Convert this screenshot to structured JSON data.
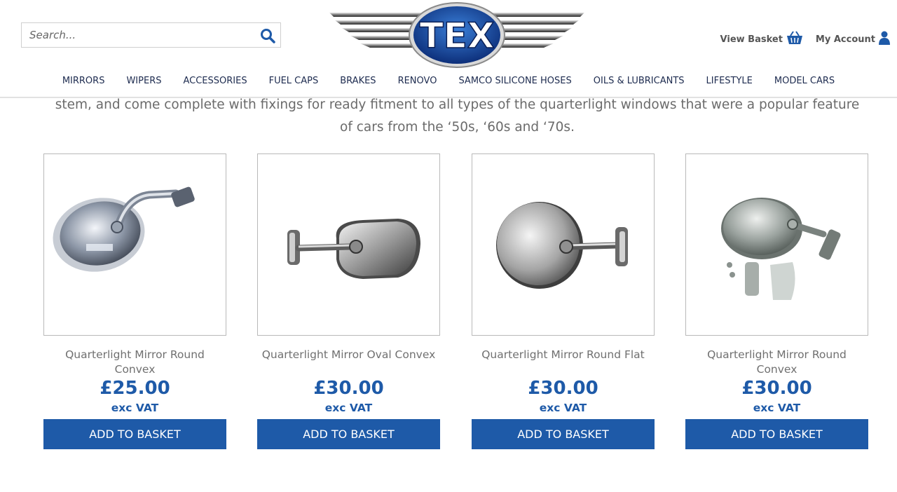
{
  "search": {
    "placeholder": "Search...",
    "value": ""
  },
  "logo": {
    "text": "TEX"
  },
  "account": {
    "basket_label": "View Basket",
    "account_label": "My Account"
  },
  "nav": {
    "items": [
      "MIRRORS",
      "WIPERS",
      "ACCESSORIES",
      "FUEL CAPS",
      "BRAKES",
      "RENOVO",
      "SAMCO SILICONE HOSES",
      "OILS & LUBRICANTS",
      "LIFESTYLE",
      "MODEL CARS"
    ]
  },
  "intro": {
    "line1": "stem, and come complete with fixings for ready fitment to all types of the quarterlight windows that were a popular feature",
    "line2": "of cars from the ‘50s, ‘60s and ‘70s."
  },
  "products": [
    {
      "name": "Quarterlight Mirror Round Convex",
      "price": "£25.00",
      "vat": "exc VAT",
      "button": "ADD TO BASKET"
    },
    {
      "name": "Quarterlight Mirror Oval Convex",
      "price": "£30.00",
      "vat": "exc VAT",
      "button": "ADD TO BASKET"
    },
    {
      "name": "Quarterlight Mirror Round Flat",
      "price": "£30.00",
      "vat": "exc VAT",
      "button": "ADD TO BASKET"
    },
    {
      "name": "Quarterlight Mirror Round Convex",
      "price": "£30.00",
      "vat": "exc VAT",
      "button": "ADD TO BASKET"
    }
  ],
  "colors": {
    "brand_blue": "#1e5aa8",
    "nav_text": "#1d2b4f"
  },
  "icons": {
    "search": "search-icon",
    "basket": "basket-icon",
    "account": "user-icon"
  }
}
